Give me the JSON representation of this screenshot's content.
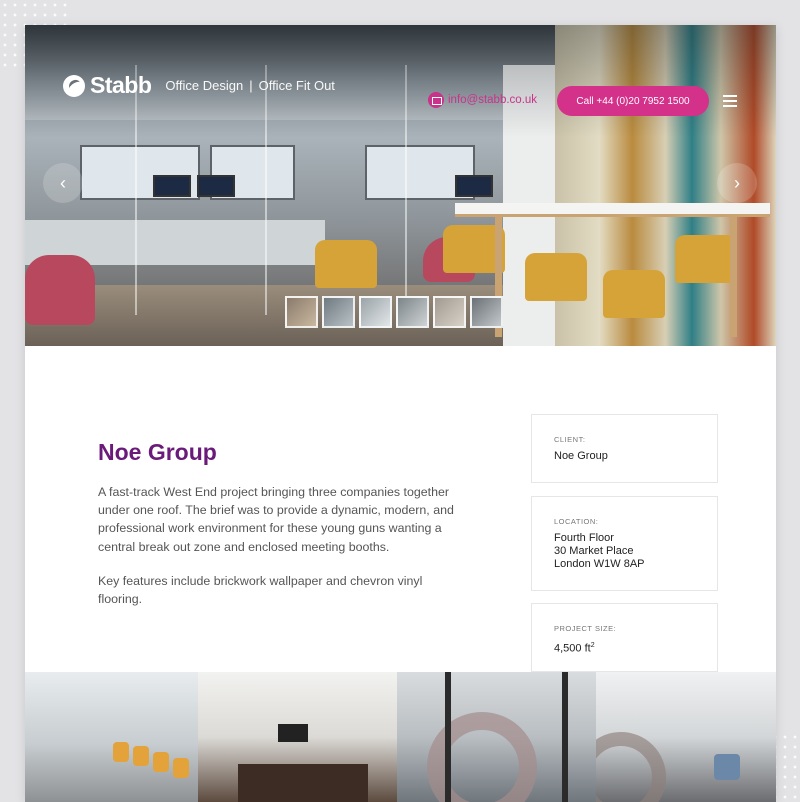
{
  "brand": {
    "name": "Stabb",
    "tagline_1": "Office Design",
    "tagline_sep": "|",
    "tagline_2": "Office Fit Out"
  },
  "header": {
    "email": "info@stabb.co.uk",
    "call_button": "Call +44 (0)20 7952 1500"
  },
  "slider": {
    "prev_glyph": "‹",
    "next_glyph": "›",
    "thumbnail_count": 6
  },
  "project": {
    "title": "Noe Group",
    "paragraph_1": "A fast-track West End project bringing three companies together under one roof. The brief was to provide a dynamic, modern, and professional work environment for these young guns wanting a central break out zone and enclosed meeting booths.",
    "paragraph_2": "Key features include brickwork wallpaper and chevron vinyl flooring."
  },
  "info": {
    "client_label": "CLIENT:",
    "client_value": "Noe Group",
    "location_label": "LOCATION:",
    "location_line_1": "Fourth Floor",
    "location_line_2": "30 Market Place",
    "location_line_3": "London W1W 8AP",
    "size_label": "PROJECT SIZE:",
    "size_value": "4,500 ft",
    "size_unit_sup": "2"
  },
  "colors": {
    "brand_purple": "#6a1b7a",
    "accent_pink": "#d4318b"
  }
}
